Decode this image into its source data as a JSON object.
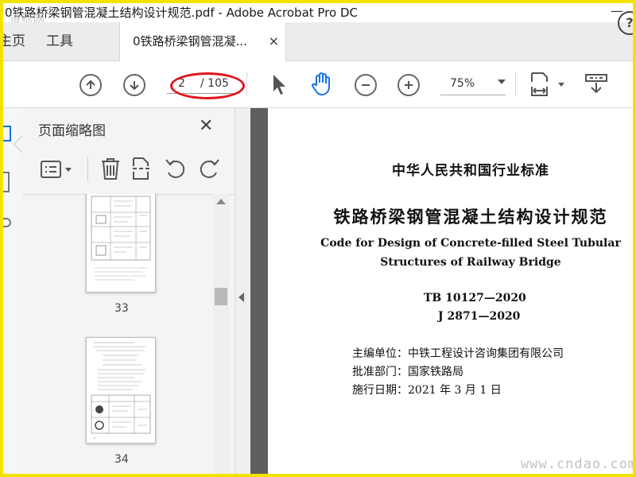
{
  "window": {
    "title": "0铁路桥梁钢管混凝土结构设计规范.pdf - Adobe Acrobat Pro DC",
    "minimize_glyph": "—"
  },
  "watermarks": {
    "top": "道标网",
    "bottom": "www.cndao.com"
  },
  "tabs": {
    "home_label": "主页",
    "tools_label": "工具",
    "document_label": "0铁路桥梁钢管混凝...",
    "close_glyph": "×",
    "help_glyph": "?"
  },
  "toolbar": {
    "current_page": "2",
    "total_pages": "/ 105",
    "zoom": "75%",
    "annotation_color": "#e2161c"
  },
  "thumbnail_panel": {
    "title": "页面缩略图",
    "close_glyph": "✕",
    "thumbnails": [
      {
        "page_number": "33"
      },
      {
        "page_number": "34"
      }
    ]
  },
  "document": {
    "standard_type": "中华人民共和国行业标准",
    "cn_title": "铁路桥梁钢管混凝土结构设计规范",
    "en_title_line1": "Code for Design of Concrete-filled Steel Tubular",
    "en_title_line2": "Structures of Railway Bridge",
    "code1": "TB 10127—2020",
    "code2": "J 2871—2020",
    "info": [
      {
        "text": "主编单位：中铁工程设计咨询集团有限公司"
      },
      {
        "text": "批准部门：国家铁路局"
      },
      {
        "text": "施行日期：2021 年 3 月 1 日"
      }
    ]
  }
}
